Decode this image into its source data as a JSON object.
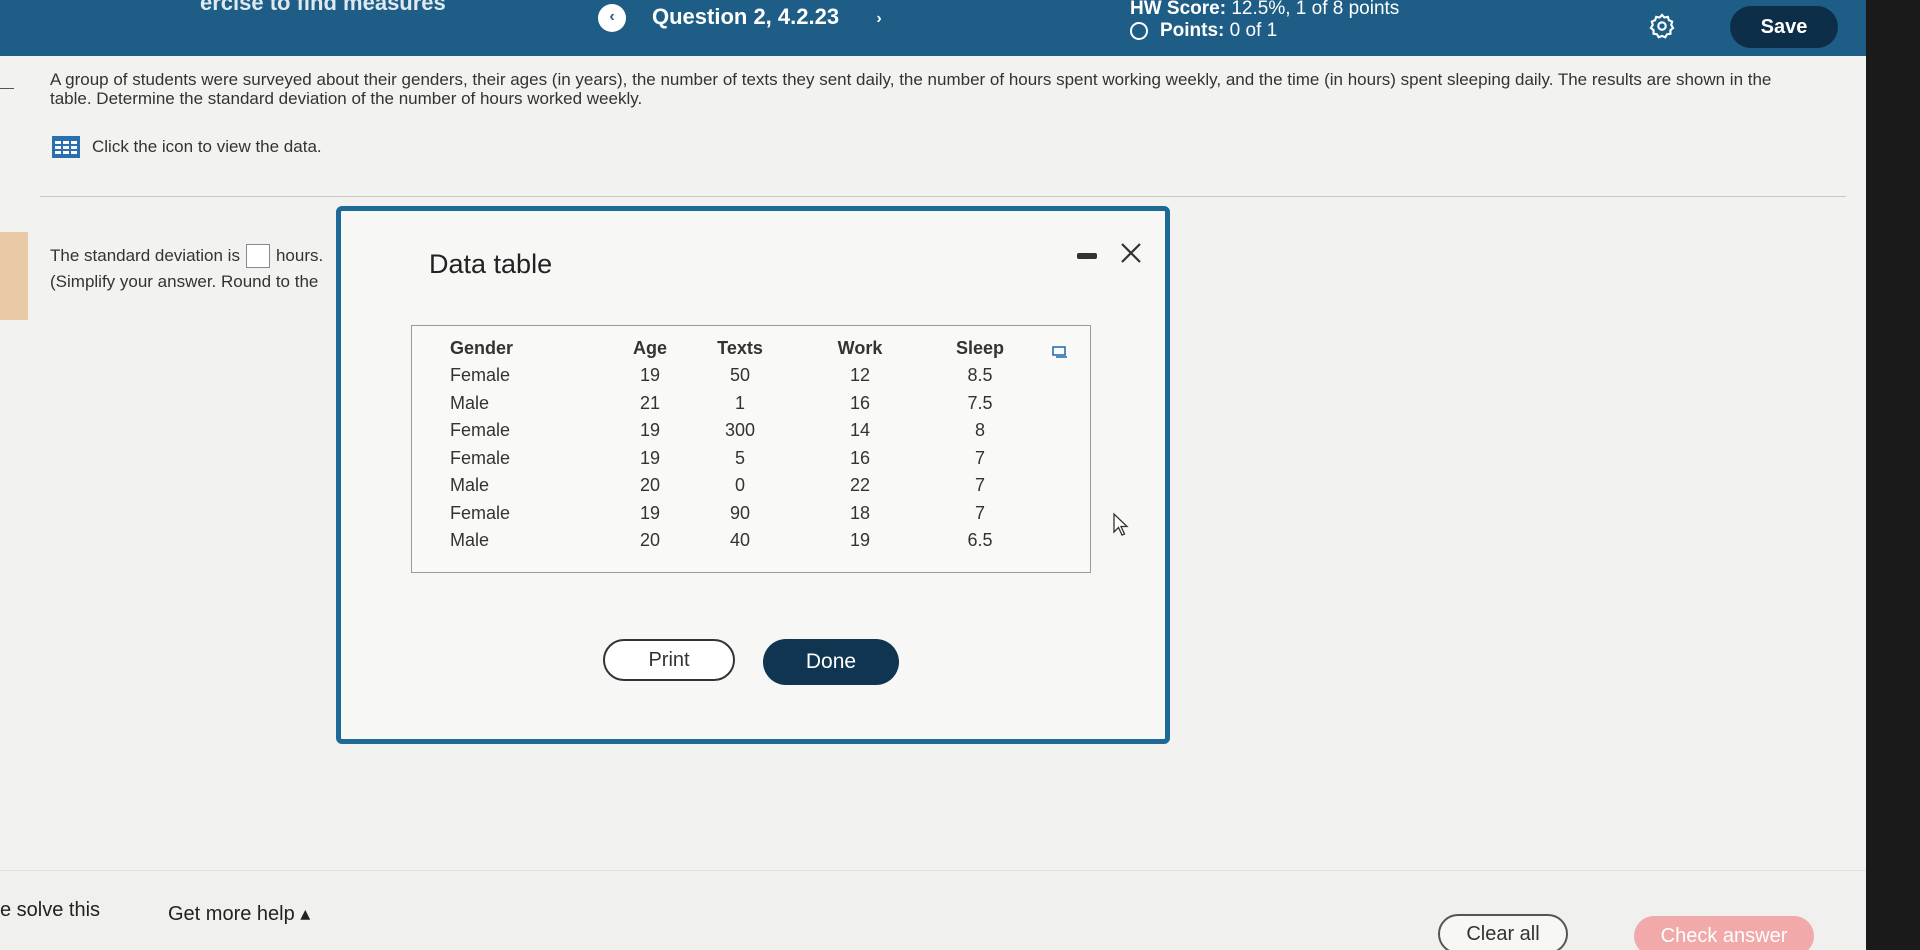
{
  "header": {
    "title_partial": "ercise to find measures",
    "question_label": "Question 2, 4.2.23",
    "prev_glyph": "‹",
    "next_glyph": "›",
    "hw_score_label": "HW Score:",
    "hw_score_value": "12.5%, 1 of 8 points",
    "points_label": "Points:",
    "points_value": "0 of 1",
    "save_label": "Save"
  },
  "question": {
    "text": "A group of students were surveyed about their genders, their ages (in years), the number of texts they sent daily, the number of hours spent working weekly, and the time (in hours) spent sleeping daily. The results are shown in the table. Determine the standard deviation of the number of hours worked weekly.",
    "data_link": "Click the icon to view the data.",
    "answer_prefix": "The standard deviation is",
    "answer_suffix": "hours.",
    "answer_hint": "(Simplify your answer. Round to the"
  },
  "modal": {
    "title": "Data table",
    "headers": [
      "Gender",
      "Age",
      "Texts",
      "Work",
      "Sleep"
    ],
    "rows": [
      [
        "Female",
        "19",
        "50",
        "12",
        "8.5"
      ],
      [
        "Male",
        "21",
        "1",
        "16",
        "7.5"
      ],
      [
        "Female",
        "19",
        "300",
        "14",
        "8"
      ],
      [
        "Female",
        "19",
        "5",
        "16",
        "7"
      ],
      [
        "Male",
        "20",
        "0",
        "22",
        "7"
      ],
      [
        "Female",
        "19",
        "90",
        "18",
        "7"
      ],
      [
        "Male",
        "20",
        "40",
        "19",
        "6.5"
      ]
    ],
    "print_label": "Print",
    "done_label": "Done"
  },
  "footer": {
    "solve_label": "e solve this",
    "help_label": "Get more help ▴",
    "clear_label": "Clear all",
    "check_label": "Check answer"
  },
  "colors": {
    "header_bg": "#1e5e86",
    "modal_border": "#1e6a96",
    "done_bg": "#0f3550",
    "save_bg": "#0d2e48",
    "check_bg": "#f2a9a9"
  }
}
